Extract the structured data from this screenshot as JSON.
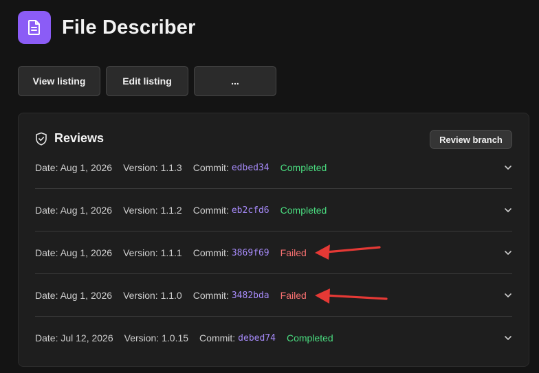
{
  "app": {
    "title": "File Describer",
    "icon": "document-icon",
    "accent": "#8b5cf6"
  },
  "toolbar": {
    "view_listing": "View listing",
    "edit_listing": "Edit listing",
    "more": "..."
  },
  "reviews": {
    "title": "Reviews",
    "icon": "shield-icon",
    "branch_button": "Review branch",
    "items": [
      {
        "date": "Date: Aug 1, 2026",
        "version": "Version: 1.1.3",
        "commit_label": "Commit:",
        "commit": "edbed34",
        "status": "Completed",
        "status_color": "#4ade80"
      },
      {
        "date": "Date: Aug 1, 2026",
        "version": "Version: 1.1.2",
        "commit_label": "Commit:",
        "commit": "eb2cfd6",
        "status": "Completed",
        "status_color": "#4ade80"
      },
      {
        "date": "Date: Aug 1, 2026",
        "version": "Version: 1.1.1",
        "commit_label": "Commit:",
        "commit": "3869f69",
        "status": "Failed",
        "status_color": "#f87171"
      },
      {
        "date": "Date: Aug 1, 2026",
        "version": "Version: 1.1.0",
        "commit_label": "Commit:",
        "commit": "3482bda",
        "status": "Failed",
        "status_color": "#f87171"
      },
      {
        "date": "Date: Jul 12, 2026",
        "version": "Version: 1.0.15",
        "commit_label": "Commit:",
        "commit": "debed74",
        "status": "Completed",
        "status_color": "#4ade80"
      }
    ]
  },
  "annotations": {
    "arrow_color": "#e53935"
  }
}
